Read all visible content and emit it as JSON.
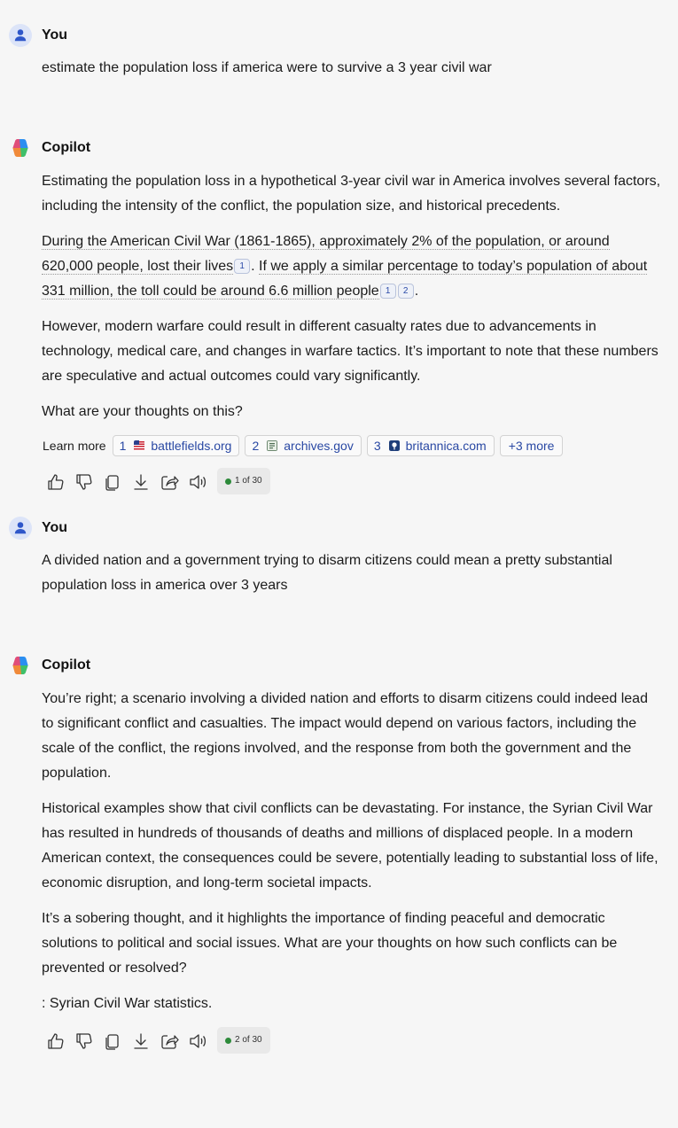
{
  "messages": [
    {
      "author": "You",
      "text": "estimate the population loss if america were to survive a 3 year civil war"
    },
    {
      "author": "Copilot",
      "p1": "Estimating the population loss in a hypothetical 3-year civil war in America involves several factors, including the intensity of the conflict, the population size, and historical precedents.",
      "p2a": "During the American Civil War (1861-1865), approximately 2% of the population, or around 620,000 people, lost their lives",
      "p2b": "If we apply a similar percentage to today’s population of about 331 million, the toll could be around 6.6 million people",
      "cite1": "1",
      "cite2": "2",
      "p3": "However, modern warfare could result in different casualty rates due to advancements in technology, medical care, and changes in warfare tactics. It’s important to note that these numbers are speculative and actual outcomes could vary significantly.",
      "p4": "What are your thoughts on this?",
      "learn_more_label": "Learn more",
      "sources": [
        {
          "num": "1",
          "domain": "battlefields.org",
          "icon": "flag-icon"
        },
        {
          "num": "2",
          "domain": "archives.gov",
          "icon": "document-icon"
        },
        {
          "num": "3",
          "domain": "britannica.com",
          "icon": "thistle-icon"
        }
      ],
      "more_sources": "+3 more",
      "counter": "1 of 30"
    },
    {
      "author": "You",
      "text": "A divided nation and a government trying to disarm citizens could mean a pretty substantial population loss in america over 3 years"
    },
    {
      "author": "Copilot",
      "p1": "You’re right; a scenario involving a divided nation and efforts to disarm citizens could indeed lead to significant conflict and casualties. The impact would depend on various factors, including the scale of the conflict, the regions involved, and the response from both the government and the population.",
      "p2": "Historical examples show that civil conflicts can be devastating. For instance, the Syrian Civil War has resulted in hundreds of thousands of deaths and millions of displaced people. In a modern American context, the consequences could be severe, potentially leading to substantial loss of life, economic disruption, and long-term societal impacts.",
      "p3": "It’s a sobering thought, and it highlights the importance of finding peaceful and democratic solutions to political and social issues. What are your thoughts on how such conflicts can be prevented or resolved?",
      "p4": ": Syrian Civil War statistics.",
      "counter": "2 of 30"
    }
  ],
  "colors": {
    "background": "#f6f6f6",
    "link": "#2948a3",
    "status_dot": "#2d8a3a",
    "user_avatar": "#dce4f8"
  },
  "action_icons": [
    "thumbs-up-icon",
    "thumbs-down-icon",
    "copy-icon",
    "download-icon",
    "share-icon",
    "read-aloud-icon"
  ]
}
